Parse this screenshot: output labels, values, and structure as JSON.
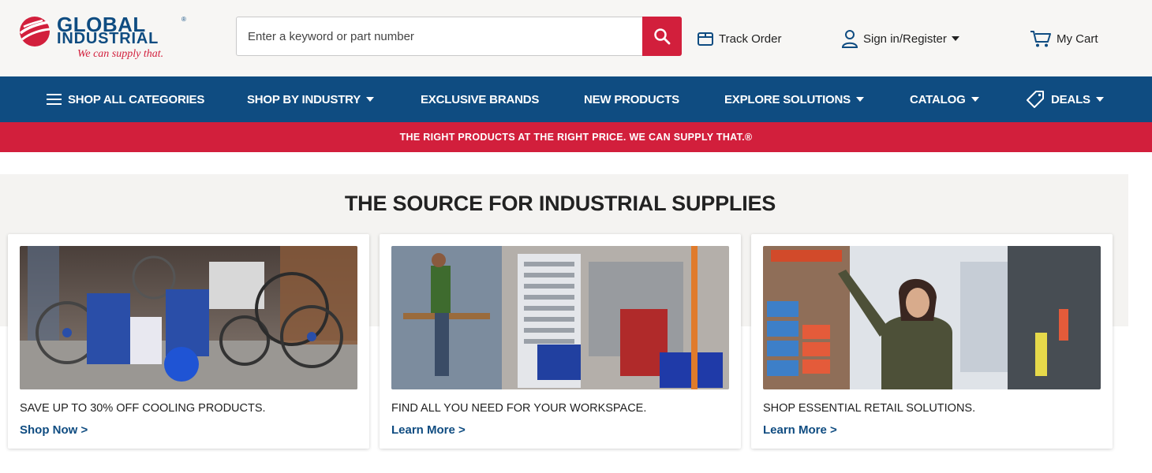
{
  "brand": {
    "name_line1": "GLOBAL",
    "name_line2": "INDUSTRIAL",
    "registered": "®",
    "tagline": "We can supply that.",
    "colors": {
      "blue": "#0f4c81",
      "red": "#d21f3c"
    }
  },
  "search": {
    "placeholder": "Enter a keyword or part number",
    "button_icon": "search-icon"
  },
  "utility": {
    "track_order": "Track Order",
    "sign_in": "Sign in/Register",
    "cart": "My Cart"
  },
  "nav": {
    "shop_all": "SHOP ALL CATEGORIES",
    "shop_by_industry": "SHOP BY INDUSTRY",
    "exclusive_brands": "EXCLUSIVE BRANDS",
    "new_products": "NEW PRODUCTS",
    "explore_solutions": "EXPLORE SOLUTIONS",
    "catalog": "CATALOG",
    "deals": "DEALS"
  },
  "promo": {
    "text": "THE RIGHT PRODUCTS AT THE RIGHT PRICE. WE CAN SUPPLY THAT.®"
  },
  "main": {
    "title": "THE SOURCE FOR INDUSTRIAL SUPPLIES",
    "cards": [
      {
        "text": "SAVE UP TO 30% OFF COOLING PRODUCTS.",
        "link": "Shop Now >"
      },
      {
        "text": "FIND ALL YOU NEED FOR YOUR WORKSPACE.",
        "link": "Learn More >"
      },
      {
        "text": "SHOP ESSENTIAL RETAIL SOLUTIONS.",
        "link": "Learn More >"
      }
    ]
  }
}
